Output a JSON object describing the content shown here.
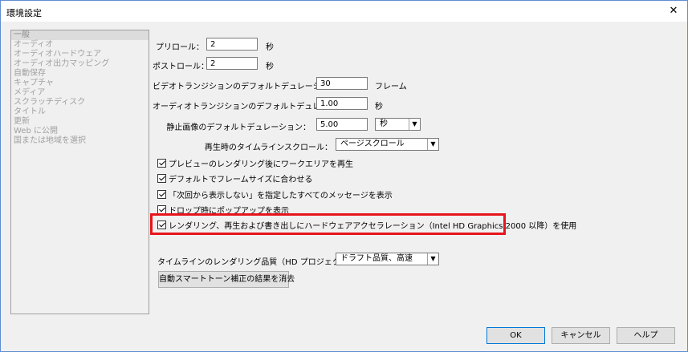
{
  "window": {
    "title": "環境設定",
    "close_glyph": "✕"
  },
  "sidebar": {
    "items": [
      "一般",
      "オーディオ",
      "オーディオハードウェア",
      "オーディオ出力マッピング",
      "自動保存",
      "キャプチャ",
      "メディア",
      "スクラッチディスク",
      "タイトル",
      "更新",
      "Web に公開",
      "国または地域を選択"
    ],
    "selected_index": 0
  },
  "settings": {
    "preroll": {
      "label": "プリロール：",
      "value": "2",
      "unit": "秒"
    },
    "postroll": {
      "label": "ポストロール：",
      "value": "2",
      "unit": "秒"
    },
    "video_transition": {
      "label": "ビデオトランジションのデフォルトデュレーション：",
      "value": "30",
      "unit": "フレーム"
    },
    "audio_transition": {
      "label": "オーディオトランジションのデフォルトデュレーション：",
      "value": "1.00",
      "unit": "秒"
    },
    "still_image": {
      "label": "静止画像のデフォルトデュレーション：",
      "value": "5.00",
      "unit_select": "秒"
    },
    "timeline_scroll": {
      "label": "再生時のタイムラインスクロール：",
      "value": "ページスクロール"
    }
  },
  "checkboxes": [
    {
      "label": "プレビューのレンダリング後にワークエリアを再生",
      "checked": true
    },
    {
      "label": "デフォルトでフレームサイズに合わせる",
      "checked": true
    },
    {
      "label": "「次回から表示しない」を指定したすべてのメッセージを表示",
      "checked": true
    },
    {
      "label": "ドロップ時にポップアップを表示",
      "checked": true
    },
    {
      "label": "レンダリング、再生および書き出しにハードウェアアクセラレーション（Intel HD Graphics 2000 以降）を使用",
      "checked": true
    }
  ],
  "render_quality": {
    "label": "タイムラインのレンダリング品質（HD プロジェクトで有効）：",
    "value": "ドラフト品質、高速"
  },
  "clear_button": "自動スマートトーン補正の結果を消去",
  "footer": {
    "ok": "OK",
    "cancel": "キャンセル",
    "help": "ヘルプ"
  },
  "colors": {
    "highlight": "#e8141c",
    "border": "#5f8dd3"
  },
  "icons": {
    "dropdown": "▼"
  }
}
